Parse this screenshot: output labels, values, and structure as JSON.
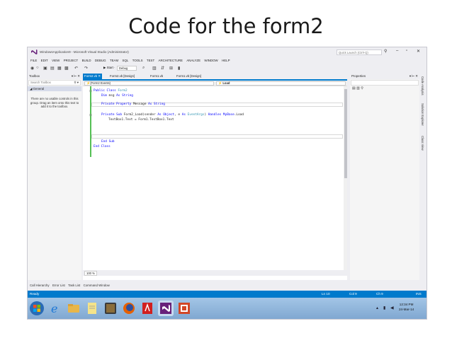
{
  "slide": {
    "title": "Code for the form2"
  },
  "window": {
    "title": "WindowsApplication9 - Microsoft Visual Studio (Administrator)",
    "quick_launch_placeholder": "Quick Launch (Ctrl+Q)",
    "min": "–",
    "restore": "▫",
    "close": "✕"
  },
  "menu": [
    "FILE",
    "EDIT",
    "VIEW",
    "PROJECT",
    "BUILD",
    "DEBUG",
    "TEAM",
    "SQL",
    "TOOLS",
    "TEST",
    "ARCHITECTURE",
    "ANALYZE",
    "WINDOW",
    "HELP"
  ],
  "toolbar": {
    "start_label": "▶ Start ·",
    "config": "Debug"
  },
  "toolbox": {
    "title": "Toolbox",
    "search_placeholder": "Search Toolbox",
    "group": "◢ General",
    "empty_message": "There are no usable controls in this group. Drag an item onto this text to add it to the toolbox."
  },
  "editor": {
    "tabs": [
      "Form2.vb  ✕",
      "Form2.vb [Design]",
      "Form1.vb",
      "Form1.vb [Design]"
    ],
    "nav_left": "⚡(Form2 Events)",
    "nav_right": "⚡ Load",
    "zoom": "100 %"
  },
  "code": {
    "l1_kw": "Public Class ",
    "l1_ty": "Form2",
    "l2_kw": "Dim ",
    "l2_id": "msg ",
    "l2_kw2": "As ",
    "l2_kw3": "String",
    "l3_kw": "Private Property ",
    "l3_id": "Message ",
    "l3_kw2": "As ",
    "l3_kw3": "String",
    "l4_kw": "Private Sub ",
    "l4_id": "Form2_Load(sender ",
    "l4_kw2": "As ",
    "l4_kw3": "Object",
    "l4_id2": ", e ",
    "l4_kw4": "As ",
    "l4_ty": "EventArgs",
    "l4_id3": ") ",
    "l4_kw5": "Handles ",
    "l4_kw6": "MyBase",
    "l4_id4": ".Load",
    "l5": "TextBox1.Text = Form1.TextBox1.Text",
    "l6_kw": "End Sub",
    "l7_kw": "End Class"
  },
  "properties": {
    "title": "Properties"
  },
  "side_tabs": [
    "Code Analysis",
    "Solution Explorer",
    "Class View"
  ],
  "bottom_tabs": [
    "Call Hierarchy",
    "Error List",
    "Task List",
    "Command Window"
  ],
  "status": {
    "ready": "Ready",
    "ln": "Ln 10",
    "col": "Col 9",
    "ch": "Ch 9",
    "ins": "INS"
  },
  "taskbar": {
    "time": "12:34 PM",
    "date": "24-Mar-14"
  },
  "colors": {
    "accent": "#007acc",
    "keyword": "#0000ff",
    "type": "#2b91af"
  }
}
